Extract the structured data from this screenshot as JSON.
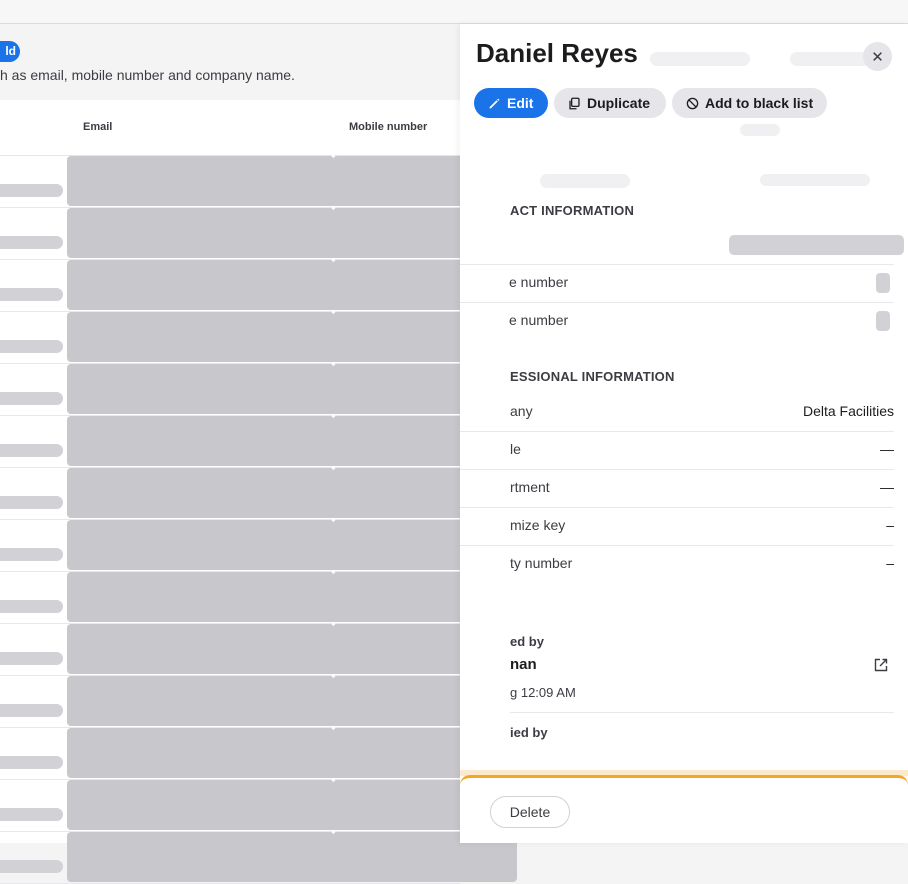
{
  "list": {
    "add_label": "ld",
    "hint": "h as email, mobile number and company name.",
    "columns": {
      "email": "Email",
      "mobile": "Mobile number"
    }
  },
  "panel": {
    "title": "Daniel Reyes",
    "actions": {
      "edit": "Edit",
      "duplicate": "Duplicate",
      "blacklist": "Add to black list"
    },
    "contact": {
      "heading": "ACT INFORMATION",
      "mobile_label": "e number",
      "phone_label": "e number"
    },
    "professional": {
      "heading": "ESSIONAL INFORMATION",
      "company_label": "any",
      "company_value": "Delta Facilities",
      "title_label": "le",
      "title_value": "—",
      "department_label": "rtment",
      "department_value": "—",
      "customize_label": "mize key",
      "customize_value": "–",
      "security_label": "ty number",
      "security_value": "–"
    },
    "meta": {
      "created_label": "ed by",
      "created_value": "nan",
      "created_date": "g 12:09 AM",
      "modified_label": "ied by"
    },
    "footer": {
      "delete": "Delete"
    }
  },
  "colors": {
    "accent": "#1a73e8",
    "warning": "#f5a623",
    "redacted": "#c7c7cc"
  },
  "icons": [
    "close-icon",
    "pencil-icon",
    "copy-icon",
    "block-icon",
    "external-link-icon"
  ]
}
